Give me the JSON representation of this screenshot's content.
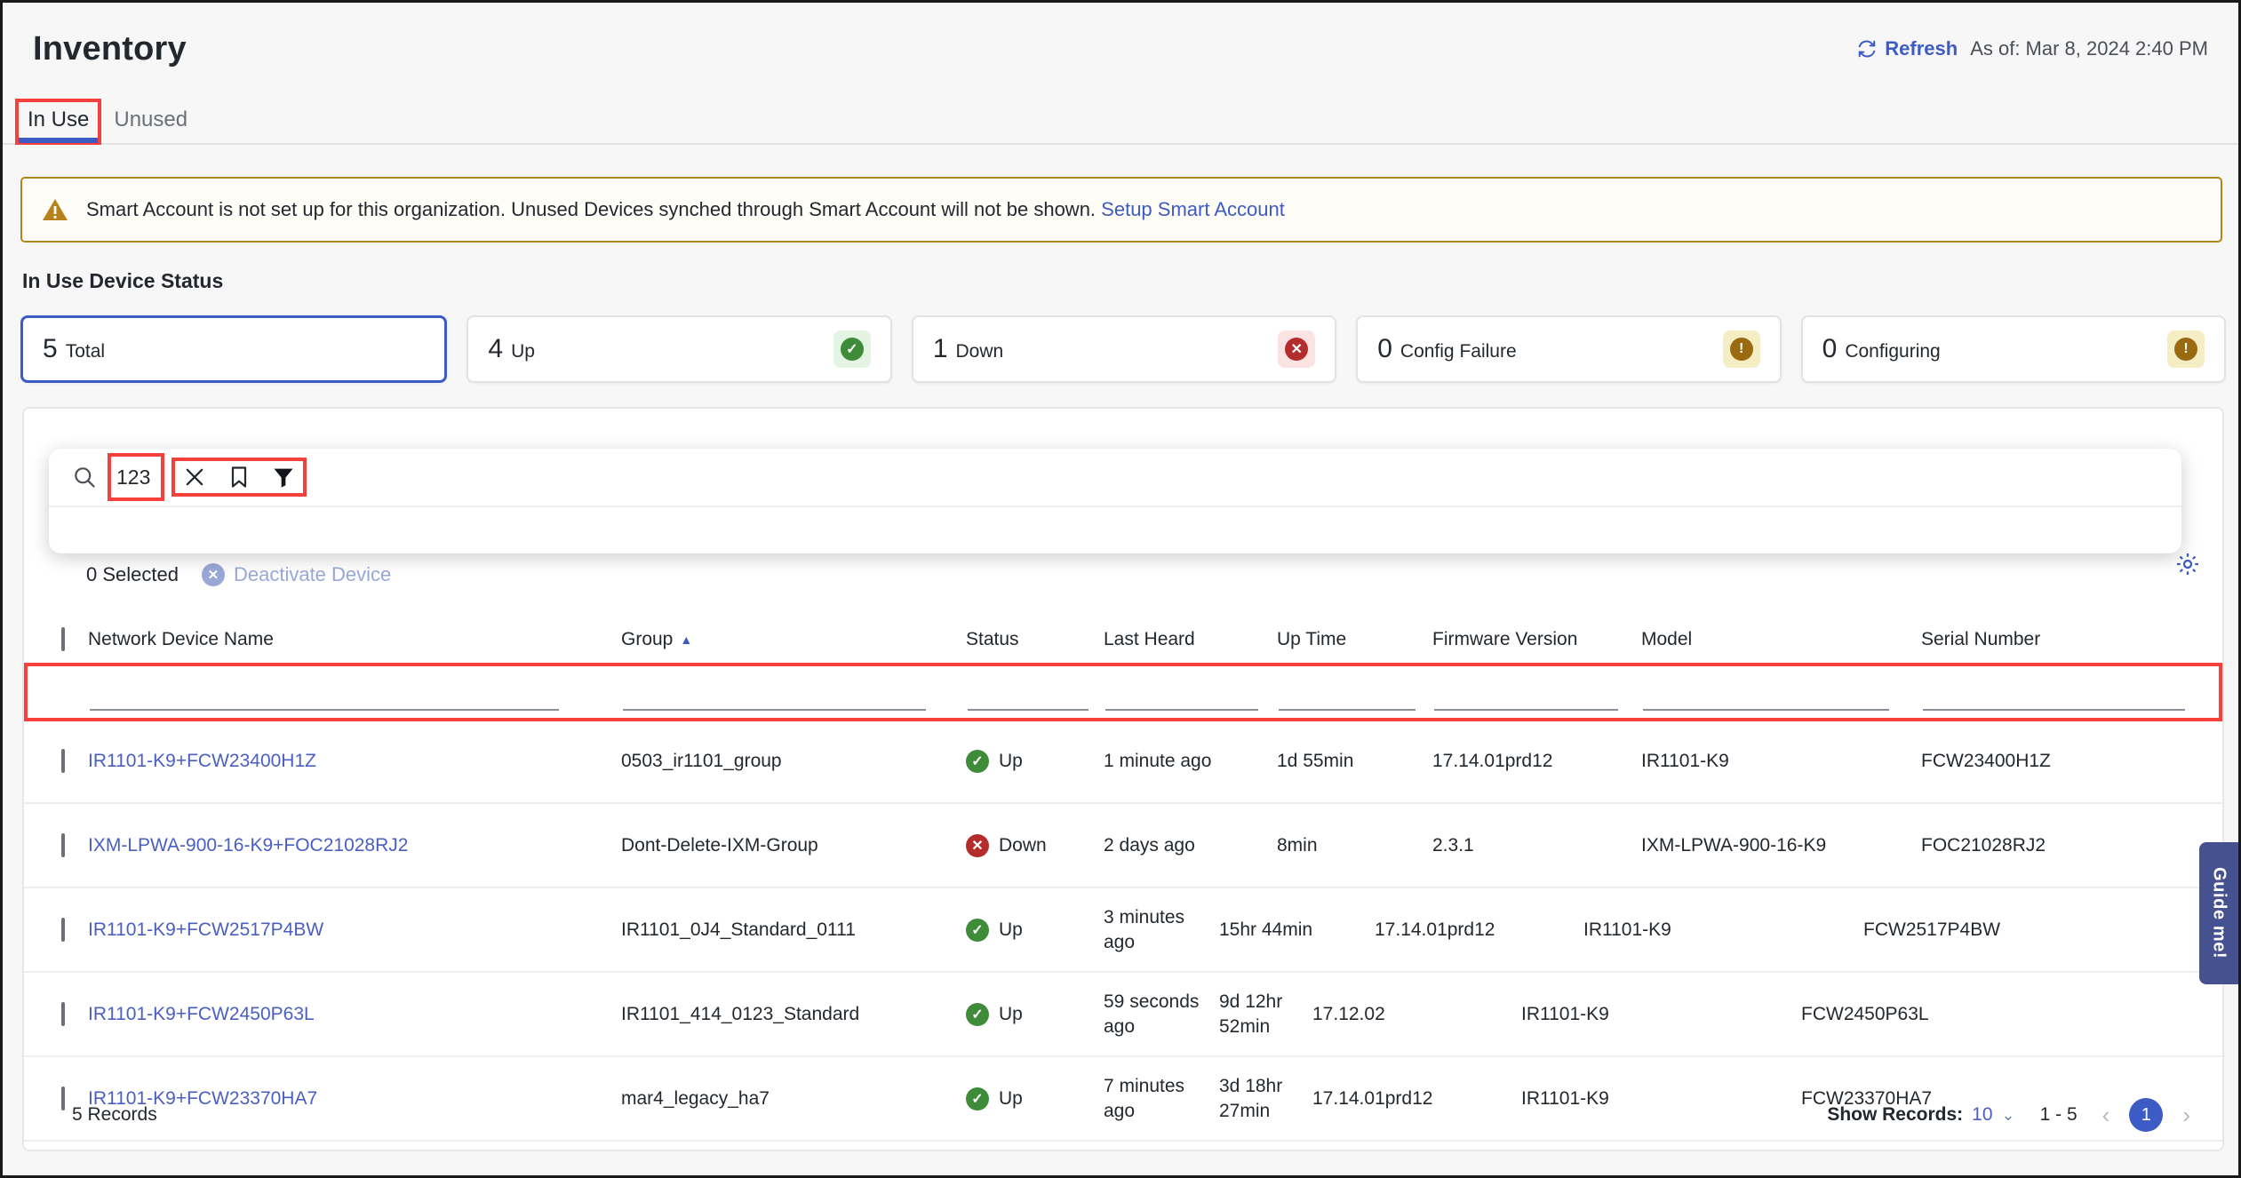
{
  "header": {
    "title": "Inventory",
    "refresh_label": "Refresh",
    "as_of": "As of: Mar 8, 2024 2:40 PM"
  },
  "tabs": [
    {
      "label": "In Use",
      "active": true
    },
    {
      "label": "Unused",
      "active": false
    }
  ],
  "banner": {
    "text": "Smart Account is not set up for this organization. Unused Devices synched through Smart Account will not be shown.",
    "link": "Setup Smart Account"
  },
  "status": {
    "section_title": "In Use Device Status",
    "cards": [
      {
        "count": "5",
        "label": "Total",
        "badge": "none",
        "selected": true
      },
      {
        "count": "4",
        "label": "Up",
        "badge": "up",
        "selected": false
      },
      {
        "count": "1",
        "label": "Down",
        "badge": "down",
        "selected": false
      },
      {
        "count": "0",
        "label": "Config Failure",
        "badge": "warn",
        "selected": false
      },
      {
        "count": "0",
        "label": "Configuring",
        "badge": "warn",
        "selected": false
      }
    ]
  },
  "search": {
    "value": "123",
    "placeholder": "",
    "icons": {
      "search": "search-icon",
      "clear": "close-icon",
      "bookmark": "bookmark-icon",
      "filter": "filter-icon"
    }
  },
  "toolbar": {
    "selected_label": "0 Selected",
    "deactivate_label": "Deactivate Device",
    "settings_icon": "gear-icon"
  },
  "table": {
    "columns": [
      {
        "label": "Network Device Name",
        "sort": ""
      },
      {
        "label": "Group",
        "sort": "asc"
      },
      {
        "label": "Status",
        "sort": ""
      },
      {
        "label": "Last Heard",
        "sort": ""
      },
      {
        "label": "Up Time",
        "sort": ""
      },
      {
        "label": "Firmware Version",
        "sort": ""
      },
      {
        "label": "Model",
        "sort": ""
      },
      {
        "label": "Serial Number",
        "sort": ""
      }
    ],
    "rows": [
      {
        "name": "IR1101-K9+FCW23400H1Z",
        "group": "0503_ir1101_group",
        "status": "Up",
        "last_heard": "1 minute ago",
        "up_time": "1d 55min",
        "firmware": "17.14.01prd12",
        "model": "IR1101-K9",
        "serial": "FCW23400H1Z"
      },
      {
        "name": "IXM-LPWA-900-16-K9+FOC21028RJ2",
        "group": "Dont-Delete-IXM-Group",
        "status": "Down",
        "last_heard": "2 days ago",
        "up_time": "8min",
        "firmware": "2.3.1",
        "model": "IXM-LPWA-900-16-K9",
        "serial": "FOC21028RJ2"
      },
      {
        "name": "IR1101-K9+FCW2517P4BW",
        "group": "IR1101_0J4_Standard_0111",
        "status": "Up",
        "last_heard": "3 minutes ago",
        "up_time": "15hr 44min",
        "firmware": "17.14.01prd12",
        "model": "IR1101-K9",
        "serial": "FCW2517P4BW"
      },
      {
        "name": "IR1101-K9+FCW2450P63L",
        "group": "IR1101_414_0123_Standard",
        "status": "Up",
        "last_heard": "59 seconds ago",
        "up_time": "9d 12hr 52min",
        "firmware": "17.12.02",
        "model": "IR1101-K9",
        "serial": "FCW2450P63L"
      },
      {
        "name": "IR1101-K9+FCW23370HA7",
        "group": "mar4_legacy_ha7",
        "status": "Up",
        "last_heard": "7 minutes ago",
        "up_time": "3d 18hr 27min",
        "firmware": "17.14.01prd12",
        "model": "IR1101-K9",
        "serial": "FCW23370HA7"
      }
    ]
  },
  "footer": {
    "records_label": "5 Records",
    "show_records_label": "Show Records:",
    "show_records_value": "10",
    "range": "1 - 5",
    "page": "1"
  },
  "guide": {
    "label": "Guide me!"
  },
  "colors": {
    "accent": "#3d5bc4",
    "link": "#4a5fc1",
    "up": "#3e8b3a",
    "down": "#b32d2d",
    "warn": "#9a6a10",
    "highlight": "#f5403c",
    "banner_border": "#b8821a"
  }
}
